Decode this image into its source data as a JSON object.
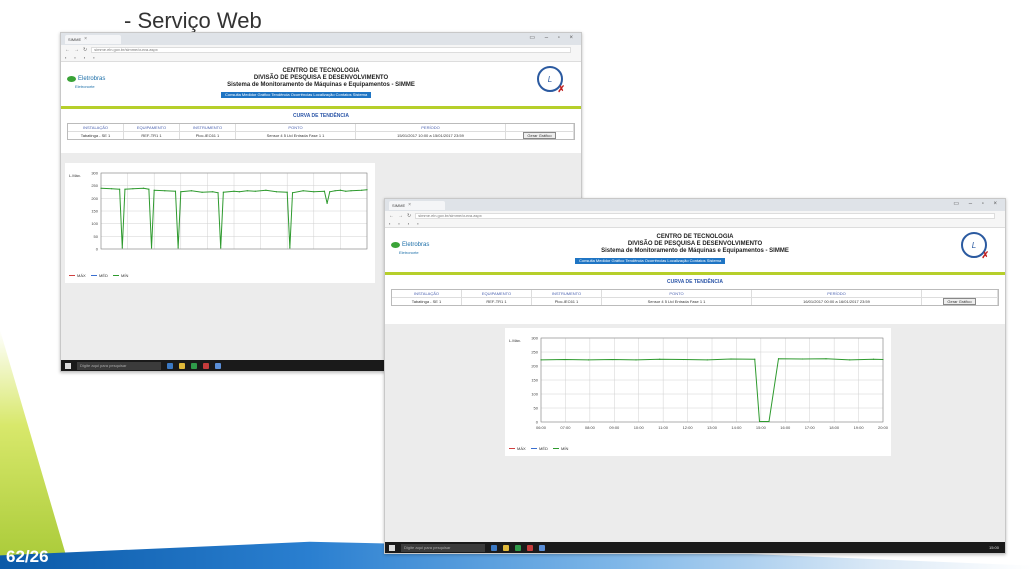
{
  "slide": {
    "title": "- Serviço Web",
    "page_number": "62/26"
  },
  "site": {
    "header_lines": [
      "CENTRO DE TECNOLOGIA",
      "DIVISÃO DE PESQUISA E DESENVOLVIMENTO",
      "Sistema de Monitoramento de Máquinas e Equipamentos - SIMME"
    ],
    "menu": "Consulta Medidor Gráfico Tendência Ocorrências Localização Contatos Sistema",
    "logo": "Eletrobras",
    "logo_sub": "Eletronorte",
    "seal_letter": "L",
    "section_title": "CURVA DE TENDÊNCIA",
    "param_headers": [
      "INSTALAÇÃO",
      "EQUIPAMENTO",
      "INSTRUMENTO",
      "PONTO",
      "PERÍODO"
    ],
    "generate_button": "Gerar Gráfico"
  },
  "window1": {
    "tab_label": "SIMME",
    "url": "simme.eln.gov.br/simme/curva.aspx",
    "param_values": [
      "Tabatinga - SE 1",
      "REF-TR1 1",
      "Ploc-IEC61 1",
      "Sensor 4 5 Ltd Entrada Fase 1 1",
      "15/01/2017 10:00",
      "15/01/2017 23:59"
    ],
    "ylabel": "L.Máx.",
    "legend": [
      "MÁX",
      "MÉD",
      "MÍN"
    ],
    "chart_data": {
      "type": "line",
      "ylim": [
        0,
        300
      ],
      "yticks": [
        0,
        50,
        100,
        150,
        200,
        250,
        300
      ],
      "x": [
        0,
        4,
        7,
        8,
        9,
        12,
        16,
        18,
        19,
        20,
        24,
        28,
        29,
        30,
        34,
        38,
        42,
        44,
        45,
        46,
        50,
        52,
        55,
        58,
        62,
        66,
        70,
        71,
        72,
        76,
        80,
        84,
        85,
        86,
        88,
        90,
        92,
        94,
        98,
        100
      ],
      "series": [
        {
          "name": "MÁX",
          "color": "#2e9a2e",
          "values": [
            240,
            238,
            236,
            4,
            236,
            238,
            240,
            236,
            4,
            232,
            230,
            228,
            4,
            226,
            230,
            224,
            226,
            222,
            4,
            224,
            228,
            226,
            230,
            228,
            232,
            226,
            224,
            4,
            222,
            230,
            226,
            228,
            180,
            226,
            230,
            232,
            228,
            230,
            232,
            234
          ]
        }
      ]
    }
  },
  "window2": {
    "tab_label": "SIMME",
    "url": "simme.eln.gov.br/simme/curva.aspx",
    "param_values": [
      "Tabatinga - SE 1",
      "REF-TR1 1",
      "Ploc-IEC61 1",
      "Sensor 4 5 Ltd Entrada Fase 1 1",
      "16/01/2017 00:00",
      "16/01/2017 23:59"
    ],
    "ylabel": "L.Máx.",
    "legend": [
      "MÁX",
      "MÉD",
      "MÍN"
    ],
    "chart_data": {
      "type": "line",
      "ylim": [
        0,
        300
      ],
      "yticks": [
        0,
        50,
        100,
        150,
        200,
        250,
        300
      ],
      "xticks": [
        "06:00",
        "07:00",
        "08:00",
        "09:00",
        "10:00",
        "11:00",
        "12:00",
        "13:00",
        "14:00",
        "15:00",
        "16:00",
        "17:00",
        "18:00",
        "19:00",
        "20:00"
      ],
      "x": [
        0,
        1,
        2,
        3,
        4,
        5,
        6,
        7,
        8,
        9,
        9.2,
        9.6,
        10,
        11,
        12,
        13,
        14,
        14.4
      ],
      "series": [
        {
          "name": "MÁX",
          "color": "#2e9a2e",
          "values": [
            222,
            223,
            222,
            223,
            222,
            224,
            223,
            222,
            225,
            224,
            2,
            2,
            226,
            225,
            226,
            222,
            224,
            223
          ]
        }
      ]
    }
  },
  "taskbar": {
    "search_placeholder": "Digite aqui para pesquisar",
    "clock": "15:00"
  }
}
